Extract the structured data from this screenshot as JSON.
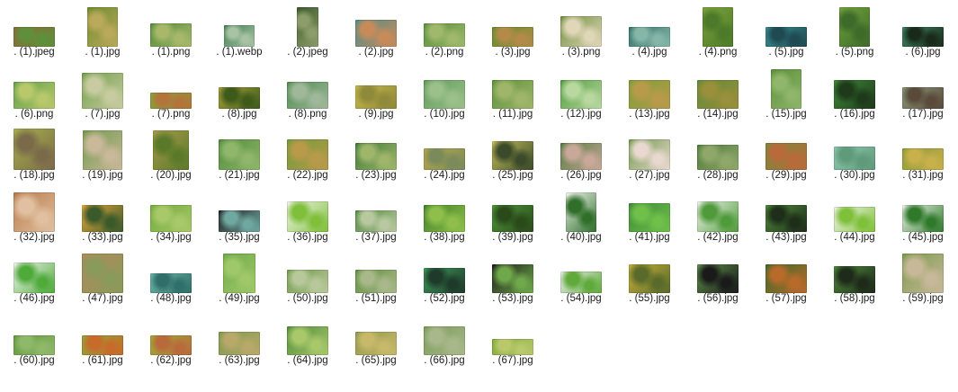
{
  "files": [
    {
      "name": ". (1).jpeg",
      "thumb": {
        "w": 46,
        "h": 22,
        "colors": [
          "#8a6a3a",
          "#5f8f3a"
        ]
      }
    },
    {
      "name": ". (1).jpg",
      "thumb": {
        "w": 34,
        "h": 44,
        "colors": [
          "#6f8a2f",
          "#b9a95a"
        ]
      }
    },
    {
      "name": ". (1).png",
      "thumb": {
        "w": 46,
        "h": 26,
        "colors": [
          "#4e8a3a",
          "#a7b86a"
        ]
      }
    },
    {
      "name": ". (1).webp",
      "thumb": {
        "w": 34,
        "h": 24,
        "colors": [
          "#3f7f52",
          "#a8c3a4"
        ]
      }
    },
    {
      "name": ". (2).jpeg",
      "thumb": {
        "w": 24,
        "h": 44,
        "colors": [
          "#3c5a2b",
          "#8c9c6a"
        ]
      }
    },
    {
      "name": ". (2).jpg",
      "thumb": {
        "w": 46,
        "h": 30,
        "colors": [
          "#4b8f8a",
          "#c98a5a"
        ]
      }
    },
    {
      "name": ". (2).png",
      "thumb": {
        "w": 46,
        "h": 26,
        "colors": [
          "#558f3c",
          "#9fb86a"
        ]
      }
    },
    {
      "name": ". (3).jpg",
      "thumb": {
        "w": 46,
        "h": 22,
        "colors": [
          "#5f8f2a",
          "#b38a4a"
        ]
      }
    },
    {
      "name": ". (3).png",
      "thumb": {
        "w": 46,
        "h": 34,
        "colors": [
          "#6c8f3c",
          "#e0d6b8"
        ]
      }
    },
    {
      "name": ". (4).jpg",
      "thumb": {
        "w": 46,
        "h": 22,
        "colors": [
          "#2f6f6a",
          "#86b6a8"
        ]
      }
    },
    {
      "name": ". (4).png",
      "thumb": {
        "w": 34,
        "h": 44,
        "colors": [
          "#7aa23a",
          "#4d7a2a"
        ]
      }
    },
    {
      "name": ". (5).jpg",
      "thumb": {
        "w": 46,
        "h": 22,
        "colors": [
          "#3b8f92",
          "#1f4a52"
        ]
      }
    },
    {
      "name": ". (5).png",
      "thumb": {
        "w": 34,
        "h": 44,
        "colors": [
          "#6fa33a",
          "#3e6a2a"
        ]
      }
    },
    {
      "name": ". (6).jpg",
      "thumb": {
        "w": 46,
        "h": 22,
        "colors": [
          "#3f8a64",
          "#1a2a1a"
        ]
      }
    },
    {
      "name": ". (6).png",
      "thumb": {
        "w": 46,
        "h": 30,
        "colors": [
          "#5f9f4a",
          "#b8c86a"
        ]
      }
    },
    {
      "name": ". (7).jpg",
      "thumb": {
        "w": 46,
        "h": 40,
        "colors": [
          "#6f9f4a",
          "#c8cba0"
        ]
      }
    },
    {
      "name": ". (7).png",
      "thumb": {
        "w": 46,
        "h": 18,
        "colors": [
          "#7fa83a",
          "#b3743a"
        ]
      }
    },
    {
      "name": ". (8).jpg",
      "thumb": {
        "w": 46,
        "h": 24,
        "colors": [
          "#a8a23a",
          "#3e5a1a"
        ]
      }
    },
    {
      "name": ". (8).png",
      "thumb": {
        "w": 46,
        "h": 30,
        "colors": [
          "#4f8a4f",
          "#9fb89a"
        ]
      }
    },
    {
      "name": ". (9).jpg",
      "thumb": {
        "w": 46,
        "h": 26,
        "colors": [
          "#c8b84a",
          "#8f8a3a"
        ]
      }
    },
    {
      "name": ". (10).jpg",
      "thumb": {
        "w": 46,
        "h": 32,
        "colors": [
          "#5f9a5a",
          "#9bc08a"
        ]
      }
    },
    {
      "name": ". (11).jpg",
      "thumb": {
        "w": 46,
        "h": 32,
        "colors": [
          "#5a8f3a",
          "#9fb66a"
        ]
      }
    },
    {
      "name": ". (12).jpg",
      "thumb": {
        "w": 46,
        "h": 32,
        "colors": [
          "#4e9a3a",
          "#b8d8a0"
        ]
      }
    },
    {
      "name": ". (13).jpg",
      "thumb": {
        "w": 46,
        "h": 32,
        "colors": [
          "#7a9f3a",
          "#b89a4a"
        ]
      }
    },
    {
      "name": ". (14).jpg",
      "thumb": {
        "w": 46,
        "h": 32,
        "colors": [
          "#5f8a3a",
          "#9a8f3a"
        ]
      }
    },
    {
      "name": ". (15).jpg",
      "thumb": {
        "w": 34,
        "h": 44,
        "colors": [
          "#5a8f3a",
          "#8fb66a"
        ]
      }
    },
    {
      "name": ". (16).jpg",
      "thumb": {
        "w": 46,
        "h": 32,
        "colors": [
          "#3f8a3a",
          "#1e3a1a"
        ]
      }
    },
    {
      "name": ". (17).jpg",
      "thumb": {
        "w": 46,
        "h": 24,
        "colors": [
          "#8a9a7a",
          "#5a4a3a"
        ]
      }
    },
    {
      "name": ". (18).jpg",
      "thumb": {
        "w": 46,
        "h": 46,
        "colors": [
          "#a8b04a",
          "#7a6a4a"
        ]
      }
    },
    {
      "name": ". (19).jpg",
      "thumb": {
        "w": 44,
        "h": 44,
        "colors": [
          "#6f9a4a",
          "#c9b89a"
        ]
      }
    },
    {
      "name": ". (20).jpg",
      "thumb": {
        "w": 40,
        "h": 44,
        "colors": [
          "#a89a4a",
          "#5a7a2a"
        ]
      }
    },
    {
      "name": ". (21).jpg",
      "thumb": {
        "w": 46,
        "h": 34,
        "colors": [
          "#4f8a3a",
          "#8fb66a"
        ]
      }
    },
    {
      "name": ". (22).jpg",
      "thumb": {
        "w": 46,
        "h": 34,
        "colors": [
          "#6f9a3a",
          "#b89a4a"
        ]
      }
    },
    {
      "name": ". (23).jpg",
      "thumb": {
        "w": 46,
        "h": 30,
        "colors": [
          "#3f7a3a",
          "#9fb66a"
        ]
      }
    },
    {
      "name": ". (24).jpg",
      "thumb": {
        "w": 46,
        "h": 24,
        "colors": [
          "#b8a84a",
          "#7a8a5a"
        ]
      }
    },
    {
      "name": ". (25).jpg",
      "thumb": {
        "w": 46,
        "h": 32,
        "colors": [
          "#c8c05a",
          "#3a4a2a"
        ]
      }
    },
    {
      "name": ". (26).jpg",
      "thumb": {
        "w": 46,
        "h": 30,
        "colors": [
          "#4f7a3a",
          "#c9a89a"
        ]
      }
    },
    {
      "name": ". (27).jpg",
      "thumb": {
        "w": 46,
        "h": 34,
        "colors": [
          "#6f9a4a",
          "#e8d8d0"
        ]
      }
    },
    {
      "name": ". (28).jpg",
      "thumb": {
        "w": 46,
        "h": 28,
        "colors": [
          "#4f7a3a",
          "#8fa86a"
        ]
      }
    },
    {
      "name": ". (29).jpg",
      "thumb": {
        "w": 46,
        "h": 30,
        "colors": [
          "#7a8a3a",
          "#b86a3a"
        ]
      }
    },
    {
      "name": ". (30).jpg",
      "thumb": {
        "w": 46,
        "h": 26,
        "colors": [
          "#8fc8b0",
          "#5f9a7a"
        ]
      }
    },
    {
      "name": ". (31).jpg",
      "thumb": {
        "w": 46,
        "h": 24,
        "colors": [
          "#8a9a3a",
          "#c8b04a"
        ]
      }
    },
    {
      "name": ". (32).jpg",
      "thumb": {
        "w": 46,
        "h": 44,
        "colors": [
          "#b87a4a",
          "#e0c0a0"
        ]
      }
    },
    {
      "name": ". (33).jpg",
      "thumb": {
        "w": 46,
        "h": 30,
        "colors": [
          "#e8a83a",
          "#3a5a2a"
        ]
      }
    },
    {
      "name": ". (34).jpg",
      "thumb": {
        "w": 46,
        "h": 30,
        "colors": [
          "#6faa3a",
          "#a8c86a"
        ]
      }
    },
    {
      "name": ". (35).jpg",
      "thumb": {
        "w": 46,
        "h": 24,
        "colors": [
          "#1e1e1e",
          "#6fa8a0"
        ]
      }
    },
    {
      "name": ". (36).jpg",
      "thumb": {
        "w": 46,
        "h": 34,
        "colors": [
          "#f4f6ef",
          "#7fbf3a"
        ]
      }
    },
    {
      "name": ". (37).jpg",
      "thumb": {
        "w": 46,
        "h": 24,
        "colors": [
          "#4f8a3a",
          "#b8c8a0"
        ]
      }
    },
    {
      "name": ". (38).jpg",
      "thumb": {
        "w": 46,
        "h": 30,
        "colors": [
          "#3f7f2a",
          "#8fbf4a"
        ]
      }
    },
    {
      "name": ". (39).jpg",
      "thumb": {
        "w": 46,
        "h": 30,
        "colors": [
          "#4f9a3a",
          "#2a4a1a"
        ]
      }
    },
    {
      "name": ". (40).jpg",
      "thumb": {
        "w": 34,
        "h": 44,
        "colors": [
          "#f2f4ee",
          "#2f6f2a"
        ]
      }
    },
    {
      "name": ". (41).jpg",
      "thumb": {
        "w": 46,
        "h": 32,
        "colors": [
          "#3f8a3a",
          "#6fbf4a"
        ]
      }
    },
    {
      "name": ". (42).jpg",
      "thumb": {
        "w": 46,
        "h": 34,
        "colors": [
          "#f3f6f0",
          "#4f9a3a"
        ]
      }
    },
    {
      "name": ". (43).jpg",
      "thumb": {
        "w": 46,
        "h": 30,
        "colors": [
          "#4f8a3a",
          "#1e2e1a"
        ]
      }
    },
    {
      "name": ". (44).jpg",
      "thumb": {
        "w": 46,
        "h": 28,
        "colors": [
          "#f5f7f2",
          "#7fc03a"
        ]
      }
    },
    {
      "name": ". (45).jpg",
      "thumb": {
        "w": 46,
        "h": 30,
        "colors": [
          "#f4f6f0",
          "#2f7a2a"
        ]
      }
    },
    {
      "name": ". (46).jpg",
      "thumb": {
        "w": 46,
        "h": 34,
        "colors": [
          "#f5f7f3",
          "#4faa3a"
        ]
      }
    },
    {
      "name": ". (47).jpg",
      "thumb": {
        "w": 46,
        "h": 44,
        "colors": [
          "#b08a5a",
          "#8a9a5a"
        ]
      }
    },
    {
      "name": ". (48).jpg",
      "thumb": {
        "w": 46,
        "h": 22,
        "colors": [
          "#6fb8a8",
          "#2f6f6a"
        ]
      }
    },
    {
      "name": ". (49).jpg",
      "thumb": {
        "w": 36,
        "h": 44,
        "colors": [
          "#6faa4a",
          "#9fc86a"
        ]
      }
    },
    {
      "name": ". (50).jpg",
      "thumb": {
        "w": 46,
        "h": 26,
        "colors": [
          "#6f9a4a",
          "#b8c89a"
        ]
      }
    },
    {
      "name": ". (51).jpg",
      "thumb": {
        "w": 46,
        "h": 26,
        "colors": [
          "#5f8f3a",
          "#a8b88a"
        ]
      }
    },
    {
      "name": ". (52).jpg",
      "thumb": {
        "w": 46,
        "h": 28,
        "colors": [
          "#3f9a5a",
          "#1e3a2a"
        ]
      }
    },
    {
      "name": ". (53).jpg",
      "thumb": {
        "w": 46,
        "h": 32,
        "colors": [
          "#1a1a1a",
          "#6fa84a"
        ]
      }
    },
    {
      "name": ". (54).jpg",
      "thumb": {
        "w": 46,
        "h": 24,
        "colors": [
          "#f0f0f0",
          "#5faa3a"
        ]
      }
    },
    {
      "name": ". (55).jpg",
      "thumb": {
        "w": 46,
        "h": 32,
        "colors": [
          "#c8b03a",
          "#5a6a2a"
        ]
      }
    },
    {
      "name": ". (56).jpg",
      "thumb": {
        "w": 46,
        "h": 32,
        "colors": [
          "#5f8f4a",
          "#1a1a1a"
        ]
      }
    },
    {
      "name": ". (57).jpg",
      "thumb": {
        "w": 46,
        "h": 32,
        "colors": [
          "#3a6a2a",
          "#b86a2a"
        ]
      }
    },
    {
      "name": ". (58).jpg",
      "thumb": {
        "w": 46,
        "h": 30,
        "colors": [
          "#4f8a3a",
          "#1e2a1a"
        ]
      }
    },
    {
      "name": ". (59).jpg",
      "thumb": {
        "w": 46,
        "h": 44,
        "colors": [
          "#7a9a4a",
          "#c8b89a"
        ]
      }
    },
    {
      "name": ". (60).jpg",
      "thumb": {
        "w": 46,
        "h": 22,
        "colors": [
          "#5f9a3a",
          "#8fb86a"
        ]
      }
    },
    {
      "name": ". (61).jpg",
      "thumb": {
        "w": 46,
        "h": 22,
        "colors": [
          "#8fa83a",
          "#c86a2a"
        ]
      }
    },
    {
      "name": ". (62).jpg",
      "thumb": {
        "w": 46,
        "h": 22,
        "colors": [
          "#9fb03a",
          "#b86a3a"
        ]
      }
    },
    {
      "name": ". (63).jpg",
      "thumb": {
        "w": 46,
        "h": 26,
        "colors": [
          "#7a9a4a",
          "#b8a86a"
        ]
      }
    },
    {
      "name": ". (64).jpg",
      "thumb": {
        "w": 46,
        "h": 32,
        "colors": [
          "#4f8a3a",
          "#a8c86a"
        ]
      }
    },
    {
      "name": ". (65).jpg",
      "thumb": {
        "w": 46,
        "h": 26,
        "colors": [
          "#8f9a4a",
          "#c8b86a"
        ]
      }
    },
    {
      "name": ". (66).jpg",
      "thumb": {
        "w": 46,
        "h": 32,
        "colors": [
          "#7a9a5a",
          "#a8b88a"
        ]
      }
    },
    {
      "name": ". (67).jpg",
      "thumb": {
        "w": 46,
        "h": 18,
        "colors": [
          "#7fa83a",
          "#b8c86a"
        ]
      }
    }
  ]
}
